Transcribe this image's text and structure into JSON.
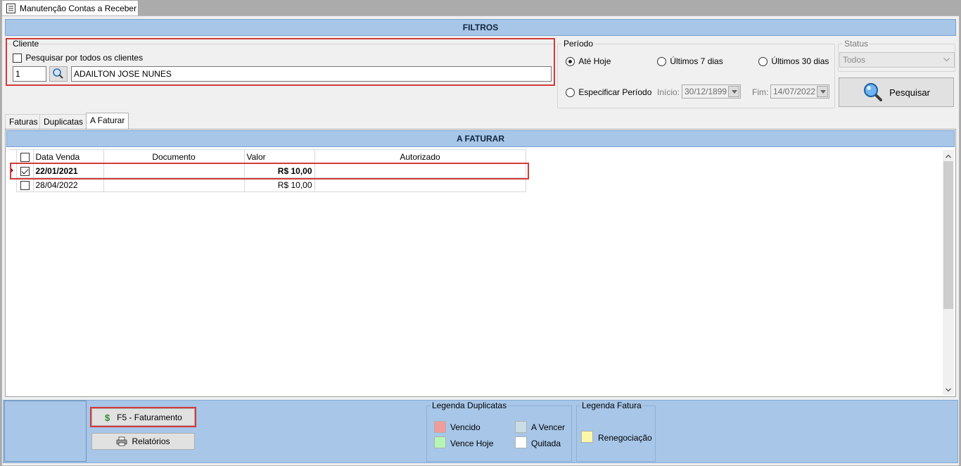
{
  "window": {
    "tab_title": "Manutenção Contas a Receber"
  },
  "filters": {
    "header": "FILTROS",
    "cliente": {
      "legend": "Cliente",
      "all_clients_label": "Pesquisar por todos os clientes",
      "code_value": "1",
      "name_value": "ADAILTON JOSE NUNES"
    },
    "periodo": {
      "legend": "Período",
      "opt_ate_hoje": "Até Hoje",
      "opt_7_dias": "Últimos 7 dias",
      "opt_30_dias": "Últimos 30 dias",
      "opt_especificar": "Especificar Período",
      "inicio_label": "Início:",
      "inicio_value": "30/12/1899",
      "fim_label": "Fim:",
      "fim_value": "14/07/2022"
    },
    "status": {
      "legend": "Status",
      "selected": "Todos"
    },
    "search_button": "Pesquisar"
  },
  "tabs": [
    "Faturas",
    "Duplicatas",
    "A Faturar"
  ],
  "grid": {
    "header": "A FATURAR",
    "columns": [
      "Data Venda",
      "Documento",
      "Valor",
      "Autorizado"
    ],
    "rows": [
      {
        "checked": true,
        "data_venda": "22/01/2021",
        "documento": "",
        "valor": "R$ 10,00",
        "autorizado": ""
      },
      {
        "checked": false,
        "data_venda": "28/04/2022",
        "documento": "",
        "valor": "R$ 10,00",
        "autorizado": ""
      }
    ]
  },
  "bottom": {
    "faturamento_button": "F5 - Faturamento",
    "relatorios_button": "Relatórios",
    "legenda_duplicatas": {
      "title": "Legenda Duplicatas",
      "vencido": "Vencido",
      "a_vencer": "A Vencer",
      "vence_hoje": "Vence Hoje",
      "quitada": "Quitada"
    },
    "legenda_fatura": {
      "title": "Legenda Fatura",
      "renegociacao": "Renegociação"
    }
  },
  "colors": {
    "vencido": "#f29b9b",
    "a_vencer": "#c8dde6",
    "vence_hoje": "#b5f5b5",
    "quitada": "#ffffff",
    "renegociacao": "#fbf7a8",
    "accent": "#a7c6e8",
    "highlight_border": "#d23b3b"
  }
}
